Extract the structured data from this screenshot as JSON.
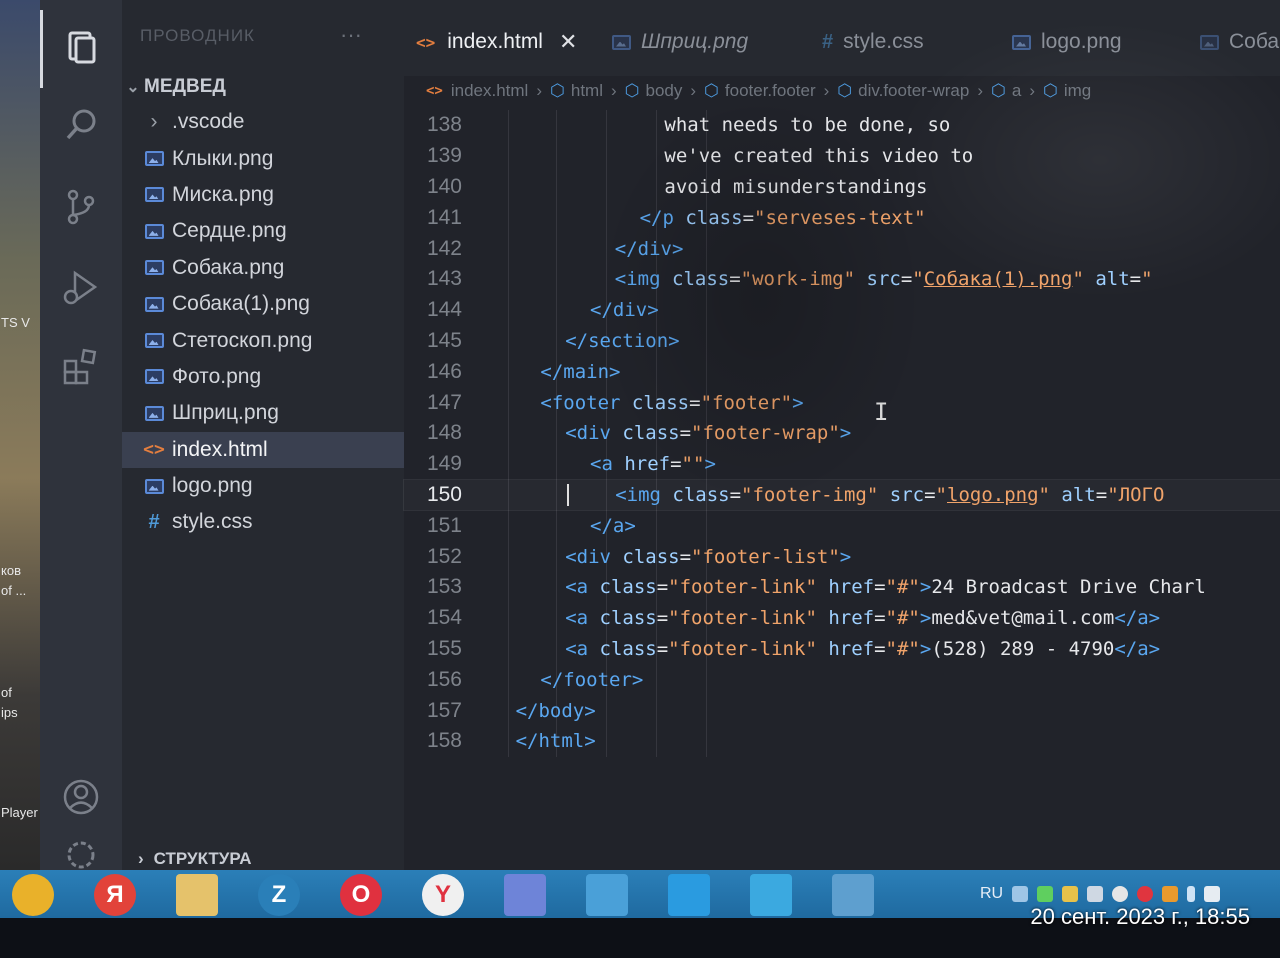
{
  "desktop": {
    "labels": [
      "TS V",
      "ков",
      "of ...",
      "of",
      "ips",
      "Player"
    ]
  },
  "activity_bar": {
    "icons": [
      "explorer-icon",
      "search-icon",
      "source-control-icon",
      "run-debug-icon",
      "extensions-icon",
      "account-icon",
      "settings-icon"
    ]
  },
  "sidebar": {
    "title": "ПРОВОДНИК",
    "more": "···",
    "folder": "МЕДВЕД",
    "items": [
      {
        "label": ".vscode",
        "type": "folder"
      },
      {
        "label": "Клыки.png",
        "type": "image"
      },
      {
        "label": "Миска.png",
        "type": "image"
      },
      {
        "label": "Сердце.png",
        "type": "image"
      },
      {
        "label": "Собака.png",
        "type": "image"
      },
      {
        "label": "Собака(1).png",
        "type": "image"
      },
      {
        "label": "Стетоскоп.png",
        "type": "image"
      },
      {
        "label": "Фото.png",
        "type": "image"
      },
      {
        "label": "Шприц.png",
        "type": "image"
      },
      {
        "label": "index.html",
        "type": "html",
        "selected": true
      },
      {
        "label": "logo.png",
        "type": "image"
      },
      {
        "label": "style.css",
        "type": "css"
      }
    ],
    "outline": "СТРУКТУРА"
  },
  "tabs": [
    {
      "label": "index.html",
      "active": true,
      "close": "✕"
    },
    {
      "label": "Шприц.png",
      "active": false,
      "italic": true
    },
    {
      "label": "style.css",
      "active": false
    },
    {
      "label": "logo.png",
      "active": false
    },
    {
      "label": "Соба",
      "active": false
    }
  ],
  "breadcrumbs": [
    "index.html",
    "html",
    "body",
    "footer.footer",
    "div.footer-wrap",
    "a",
    "img"
  ],
  "code": {
    "current_line": 150,
    "lines": [
      {
        "n": "138",
        "indent": 16,
        "parts": [
          {
            "t": "plain",
            "v": "what needs to be done, so"
          }
        ]
      },
      {
        "n": "139",
        "indent": 16,
        "parts": [
          {
            "t": "plain",
            "v": "we've created this video to"
          }
        ]
      },
      {
        "n": "140",
        "indent": 16,
        "parts": [
          {
            "t": "plain",
            "v": "avoid misunderstandings"
          }
        ]
      },
      {
        "n": "141",
        "indent": 14,
        "parts": [
          {
            "t": "tag",
            "v": "</p "
          },
          {
            "t": "attr",
            "v": "class"
          },
          {
            "t": "plain",
            "v": "="
          },
          {
            "t": "str",
            "v": "\"serveses-text\""
          }
        ]
      },
      {
        "n": "142",
        "indent": 12,
        "parts": [
          {
            "t": "tag",
            "v": "</div>"
          }
        ]
      },
      {
        "n": "143",
        "indent": 12,
        "parts": [
          {
            "t": "tag",
            "v": "<img "
          },
          {
            "t": "attr",
            "v": "class"
          },
          {
            "t": "plain",
            "v": "="
          },
          {
            "t": "str",
            "v": "\"work-img\" "
          },
          {
            "t": "attr",
            "v": "src"
          },
          {
            "t": "plain",
            "v": "="
          },
          {
            "t": "str",
            "v": "\""
          },
          {
            "t": "stru",
            "v": "Собака(1).png"
          },
          {
            "t": "str",
            "v": "\" "
          },
          {
            "t": "attr",
            "v": "alt"
          },
          {
            "t": "plain",
            "v": "="
          },
          {
            "t": "str",
            "v": "\""
          }
        ]
      },
      {
        "n": "144",
        "indent": 10,
        "parts": [
          {
            "t": "tag",
            "v": "</div>"
          }
        ]
      },
      {
        "n": "145",
        "indent": 8,
        "parts": [
          {
            "t": "tag",
            "v": "</section>"
          }
        ]
      },
      {
        "n": "146",
        "indent": 6,
        "parts": [
          {
            "t": "tag",
            "v": "</main>"
          }
        ]
      },
      {
        "n": "147",
        "indent": 6,
        "parts": [
          {
            "t": "tag",
            "v": "<footer "
          },
          {
            "t": "attr",
            "v": "class"
          },
          {
            "t": "plain",
            "v": "="
          },
          {
            "t": "str",
            "v": "\"footer\""
          },
          {
            "t": "tag",
            "v": ">"
          }
        ]
      },
      {
        "n": "148",
        "indent": 8,
        "parts": [
          {
            "t": "tag",
            "v": "<div "
          },
          {
            "t": "attr",
            "v": "class"
          },
          {
            "t": "plain",
            "v": "="
          },
          {
            "t": "str",
            "v": "\"footer-wrap\""
          },
          {
            "t": "tag",
            "v": ">"
          }
        ]
      },
      {
        "n": "149",
        "indent": 10,
        "parts": [
          {
            "t": "tag",
            "v": "<a "
          },
          {
            "t": "attr",
            "v": "href"
          },
          {
            "t": "plain",
            "v": "="
          },
          {
            "t": "str",
            "v": "\"\""
          },
          {
            "t": "tag",
            "v": ">"
          }
        ]
      },
      {
        "n": "150",
        "indent": 12,
        "parts": [
          {
            "t": "tag",
            "v": "<img "
          },
          {
            "t": "attr",
            "v": "class"
          },
          {
            "t": "plain",
            "v": "="
          },
          {
            "t": "str",
            "v": "\"footer-img\" "
          },
          {
            "t": "attr",
            "v": "src"
          },
          {
            "t": "plain",
            "v": "="
          },
          {
            "t": "str",
            "v": "\""
          },
          {
            "t": "stru",
            "v": "logo.png"
          },
          {
            "t": "str",
            "v": "\" "
          },
          {
            "t": "attr",
            "v": "alt"
          },
          {
            "t": "plain",
            "v": "="
          },
          {
            "t": "str",
            "v": "\"ЛОГО"
          }
        ]
      },
      {
        "n": "151",
        "indent": 10,
        "parts": [
          {
            "t": "tag",
            "v": "</a>"
          }
        ]
      },
      {
        "n": "152",
        "indent": 8,
        "parts": [
          {
            "t": "tag",
            "v": "<div "
          },
          {
            "t": "attr",
            "v": "class"
          },
          {
            "t": "plain",
            "v": "="
          },
          {
            "t": "str",
            "v": "\"footer-list\""
          },
          {
            "t": "tag",
            "v": ">"
          }
        ]
      },
      {
        "n": "153",
        "indent": 8,
        "parts": [
          {
            "t": "tag",
            "v": "<a "
          },
          {
            "t": "attr",
            "v": "class"
          },
          {
            "t": "plain",
            "v": "="
          },
          {
            "t": "str",
            "v": "\"footer-link\" "
          },
          {
            "t": "attr",
            "v": "href"
          },
          {
            "t": "plain",
            "v": "="
          },
          {
            "t": "str",
            "v": "\"#\""
          },
          {
            "t": "tag",
            "v": ">"
          },
          {
            "t": "plain",
            "v": "24 Broadcast Drive Charl"
          }
        ]
      },
      {
        "n": "154",
        "indent": 8,
        "parts": [
          {
            "t": "tag",
            "v": "<a "
          },
          {
            "t": "attr",
            "v": "class"
          },
          {
            "t": "plain",
            "v": "="
          },
          {
            "t": "str",
            "v": "\"footer-link\" "
          },
          {
            "t": "attr",
            "v": "href"
          },
          {
            "t": "plain",
            "v": "="
          },
          {
            "t": "str",
            "v": "\"#\""
          },
          {
            "t": "tag",
            "v": ">"
          },
          {
            "t": "plain",
            "v": "med&vet@mail.com"
          },
          {
            "t": "tag",
            "v": "</a>"
          }
        ]
      },
      {
        "n": "155",
        "indent": 8,
        "parts": [
          {
            "t": "tag",
            "v": "<a "
          },
          {
            "t": "attr",
            "v": "class"
          },
          {
            "t": "plain",
            "v": "="
          },
          {
            "t": "str",
            "v": "\"footer-link\" "
          },
          {
            "t": "attr",
            "v": "href"
          },
          {
            "t": "plain",
            "v": "="
          },
          {
            "t": "str",
            "v": "\"#\""
          },
          {
            "t": "tag",
            "v": ">"
          },
          {
            "t": "plain",
            "v": "(528) 289 - 4790"
          },
          {
            "t": "tag",
            "v": "</a>"
          }
        ]
      },
      {
        "n": "156",
        "indent": 6,
        "parts": [
          {
            "t": "tag",
            "v": "</footer>"
          }
        ]
      },
      {
        "n": "157",
        "indent": 4,
        "parts": [
          {
            "t": "tag",
            "v": "</body>"
          }
        ]
      },
      {
        "n": "158",
        "indent": 4,
        "parts": [
          {
            "t": "tag",
            "v": "</html>"
          }
        ]
      }
    ]
  },
  "taskbar": {
    "apps": [
      {
        "name": "chrome",
        "glyph": "",
        "color": "#e9b12a"
      },
      {
        "name": "yandex",
        "glyph": "Я",
        "color": "#e2433a"
      },
      {
        "name": "files",
        "glyph": "",
        "color": "#e5c26b"
      },
      {
        "name": "z-app",
        "glyph": "Z",
        "color": "#2a7fb8"
      },
      {
        "name": "opera",
        "glyph": "O",
        "color": "#e0313f"
      },
      {
        "name": "yandex-browser",
        "glyph": "Y",
        "color": "#f0f0f0"
      },
      {
        "name": "discord",
        "glyph": "",
        "color": "#6e84d8"
      },
      {
        "name": "installer",
        "glyph": "",
        "color": "#4aa0d8"
      },
      {
        "name": "vscode",
        "glyph": "",
        "color": "#2a9be0"
      },
      {
        "name": "telegram",
        "glyph": "",
        "color": "#3ba9e0"
      },
      {
        "name": "screen",
        "glyph": "",
        "color": "#5e9fcf"
      }
    ],
    "lang": "RU"
  },
  "timestamp": "20 сент. 2023 г., 18:55"
}
